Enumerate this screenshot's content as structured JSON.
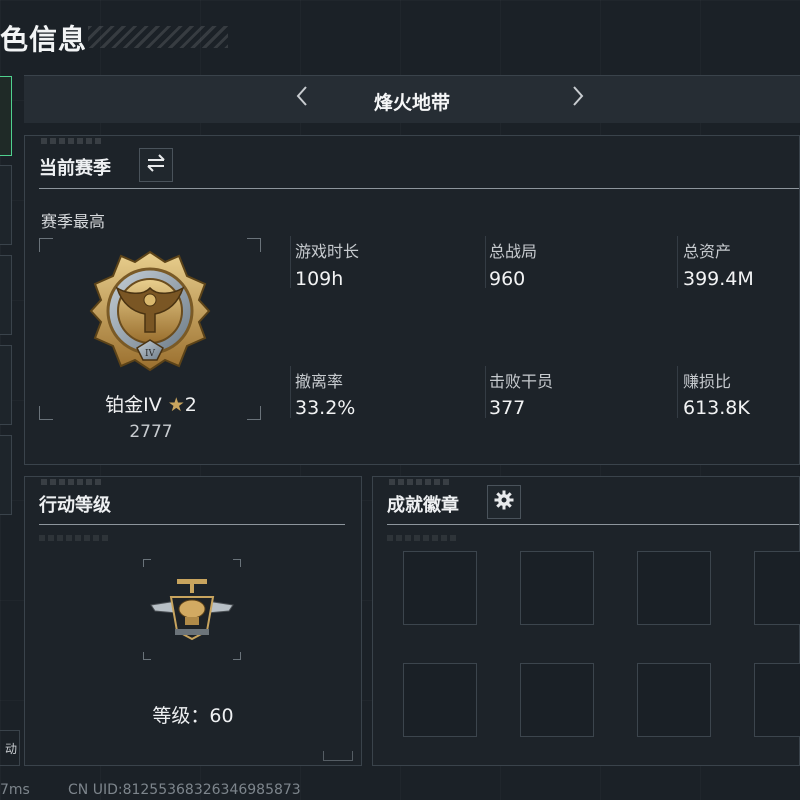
{
  "page": {
    "title": "色信息"
  },
  "side": {
    "button_label": "动"
  },
  "mode": {
    "name": "烽火地带"
  },
  "season": {
    "panel_title": "当前赛季",
    "best_label": "赛季最高",
    "rank_name": "铂金IV",
    "rank_star": "★",
    "rank_stars": "2",
    "rank_score": "2777",
    "stats": [
      {
        "label": "游戏时长",
        "value": "109h"
      },
      {
        "label": "总战局",
        "value": "960"
      },
      {
        "label": "总资产",
        "value": "399.4M"
      },
      {
        "label": "撤离率",
        "value": "33.2%"
      },
      {
        "label": "击败干员",
        "value": "377"
      },
      {
        "label": "赚损比",
        "value": "613.8K"
      }
    ]
  },
  "level": {
    "panel_title": "行动等级",
    "level_text": "等级：60"
  },
  "badges": {
    "panel_title": "成就徽章",
    "slot_count": 8
  },
  "footer": {
    "ping": "7ms",
    "uid": "CN UID:812553683263469858​73"
  },
  "colors": {
    "accent": "#4fd08e",
    "gold": "#c8a45e",
    "panel_border": "#3a434b"
  },
  "icons": {
    "swap": "swap-arrows-icon",
    "settings": "gear-icon",
    "prev": "chevron-left-icon",
    "next": "chevron-right-icon"
  }
}
